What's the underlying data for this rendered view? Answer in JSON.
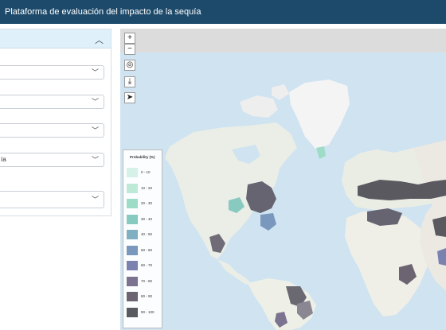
{
  "header": {
    "title": "Plataforma de evaluación del impacto de la sequía"
  },
  "panel": {
    "selects": [
      {
        "value": ""
      },
      {
        "value": ""
      },
      {
        "value": ""
      },
      {
        "value": "ía"
      },
      {
        "value": ""
      }
    ]
  },
  "map": {
    "controls": {
      "zoom_in": "+",
      "zoom_out": "−"
    },
    "legend": {
      "title": "Probability (%)",
      "items": [
        {
          "label": "0 - 10",
          "color": "#d6f1e8"
        },
        {
          "label": "10 - 20",
          "color": "#bfe9d7"
        },
        {
          "label": "20 - 30",
          "color": "#9fdcc8"
        },
        {
          "label": "30 - 40",
          "color": "#88c9c0"
        },
        {
          "label": "40 - 50",
          "color": "#7fb0c2"
        },
        {
          "label": "50 - 60",
          "color": "#7a98bd"
        },
        {
          "label": "60 - 70",
          "color": "#7c82b0"
        },
        {
          "label": "70 - 80",
          "color": "#7b738f"
        },
        {
          "label": "80 - 90",
          "color": "#6c6470"
        },
        {
          "label": "90 - 100",
          "color": "#5b5960"
        }
      ]
    }
  }
}
